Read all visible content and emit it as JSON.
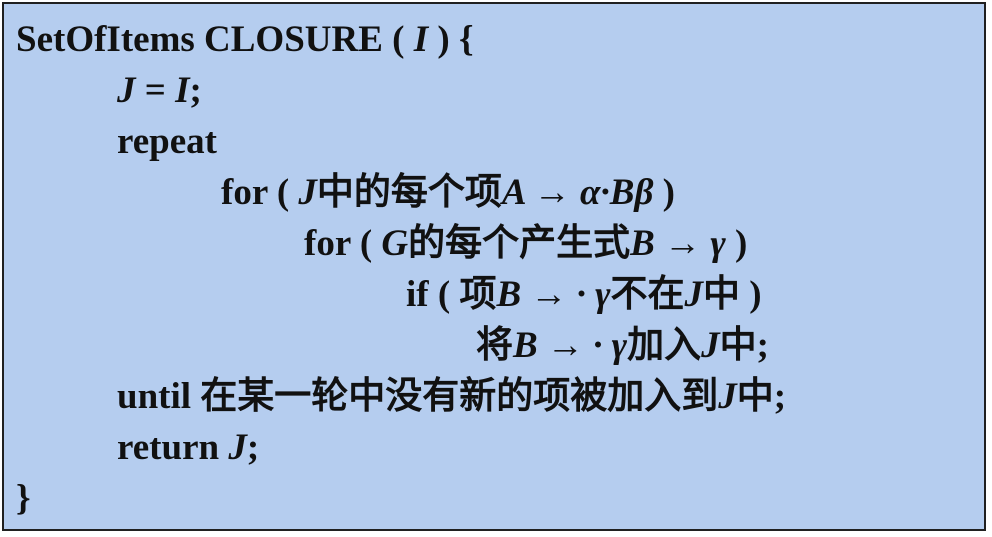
{
  "colors": {
    "background": "#b5cdef",
    "border": "#202020",
    "text": "#111111"
  },
  "code": {
    "line1": {
      "keyword": "SetOfItems CLOSURE (",
      "param": "I",
      "end": ") {"
    },
    "line2": {
      "lhs": "J",
      "eq": "=",
      "rhs": "I",
      "end": ";"
    },
    "line3": {
      "keyword": "repeat"
    },
    "line4": {
      "keyword": "for (",
      "set": "J",
      "text": "中的每个项",
      "item": "A → α·Bβ",
      "end": ")"
    },
    "line5": {
      "keyword": "for (",
      "grammar": "G",
      "text": "的每个产生式",
      "prod": "B → γ",
      "end": ")"
    },
    "line6": {
      "keyword": "if (",
      "text1": "项",
      "item": "B → · γ",
      "text2": "不在",
      "set": "J",
      "text3": "中",
      "end": ")"
    },
    "line7": {
      "text1": "将",
      "item": "B → · γ",
      "text2": "加入",
      "set": "J",
      "text3": "中",
      "end": ";"
    },
    "line8": {
      "keyword": "until",
      "text1": "在某一轮中没有新的项被加入到",
      "set": "J",
      "text2": "中",
      "end": ";"
    },
    "line9": {
      "keyword": "return",
      "set": "J",
      "end": ";"
    },
    "line10": {
      "brace": "}"
    }
  }
}
